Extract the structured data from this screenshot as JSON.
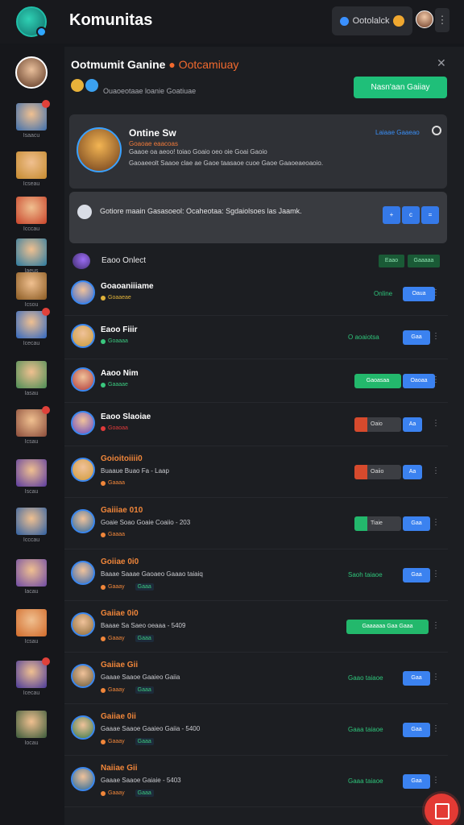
{
  "topbar": {
    "title": "Komunitas",
    "pill_label": "Ootolalck",
    "more_icon": "more-vertical-icon"
  },
  "sidebar": {
    "items": [
      {
        "label": "Isaacu",
        "color": "#3d6fae",
        "badge": true
      },
      {
        "label": "Icseau",
        "color": "#c58a2e",
        "badge": false
      },
      {
        "label": "Icccau",
        "color": "#c8432a",
        "badge": false
      },
      {
        "label": "Iaeus",
        "color": "#2a7aa0",
        "badge": false
      },
      {
        "label": "Icsou",
        "color": "#8a5a22",
        "badge": false
      },
      {
        "label": "Icecau",
        "color": "#2f67c2",
        "badge": true
      },
      {
        "label": "Iasau",
        "color": "#4b8d55",
        "badge": false
      },
      {
        "label": "Icsau",
        "color": "#8a4b3a",
        "badge": true
      },
      {
        "label": "Iscau",
        "color": "#5a3aa0",
        "badge": false
      },
      {
        "label": "Icccau",
        "color": "#2d5fa2",
        "badge": false
      },
      {
        "label": "Iacau",
        "color": "#6e4aa5",
        "badge": false
      },
      {
        "label": "Icsau",
        "color": "#d16a2a",
        "badge": false
      },
      {
        "label": "Icecau",
        "color": "#4a3a9a",
        "badge": true
      },
      {
        "label": "Iocau",
        "color": "#3a5a3a",
        "badge": false
      }
    ]
  },
  "panel": {
    "title": "Ootmumit Ganine",
    "title_accent": "Ootcamiuay",
    "subtitle": "Ouaoeotaae loanie Goatiuae",
    "join_button": "Nasn'aan Gaiiay"
  },
  "featured": {
    "name": "Ontine Sw",
    "tag": "Goaoae eaacoas",
    "line1": "Gaaoe oa aeoo! toiao Goaio oeo oie Goai Gaoio",
    "line2": "Gaoaeeolt Saaoe clae ae Gaoe taasaoe cuoe Gaoe Gaaoeaeoaoio.",
    "link": "Laiaae Gaaeao"
  },
  "notice": {
    "text": "Gotiore maain Gasasoeol: Ocaheotaa: Sgdaiolsoes las Jaamk.",
    "buttons": [
      "+",
      "c",
      "="
    ]
  },
  "members_header": {
    "label": "Eaoo Onlect",
    "btn1": "Eaao",
    "btn2": "Gaaaaa"
  },
  "members": [
    {
      "name": "Goaoaniiiame",
      "name_color": "white",
      "line": "",
      "status": "Goaaeae",
      "status_color": "#e0b23a",
      "tag": "",
      "right_label": "Online",
      "right_type": "online",
      "btn": "Oaua",
      "avatar": "#3a6ad0"
    },
    {
      "name": "Eaoo Fiiir",
      "name_color": "white",
      "line": "",
      "status": "Goaaaa",
      "status_color": "#3ac77e",
      "tag": "",
      "right_label": "O aoaiotsa",
      "right_type": "online",
      "btn": "Gaa",
      "avatar": "#c89a3a"
    },
    {
      "name": "Aaoo Nim",
      "name_color": "white",
      "line": "",
      "status": "Gaaaae",
      "status_color": "#3ac77e",
      "tag": "",
      "right_label": "Gaoasaa",
      "right_type": "green",
      "btn": "Oaoaa",
      "avatar": "#b03a3a"
    },
    {
      "name": "Eaoo Slaoiae",
      "name_color": "white",
      "line": "",
      "status": "Goaoaa",
      "status_color": "#e03a3a",
      "tag": "",
      "right_label": "Oaio",
      "right_type": "red",
      "btn": "Aa",
      "avatar": "#6a4ac0"
    },
    {
      "name": "Goioitoiiii0",
      "name_color": "orange",
      "line": "Buaaue Buao Fa - Laap",
      "status": "Gaaaa",
      "status_color": "#f0863a",
      "tag": "",
      "right_label": "Oaiio",
      "right_type": "red",
      "btn": "Aa",
      "avatar": "#d09a3a"
    },
    {
      "name": "Gaiiiae 010",
      "name_color": "orange",
      "line": "Goaie Soao Goaie Coaiio - 203",
      "status": "Gaaaa",
      "status_color": "#f0863a",
      "tag": "",
      "right_label": "Tiaie",
      "right_type": "greenbox",
      "btn": "Gaa",
      "avatar": "#2f6aa0"
    },
    {
      "name": "Goiiae 0i0",
      "name_color": "orange",
      "line": "Baaae Saaae Gaoaeo Gaaao taiaiq",
      "status": "Gaaay",
      "status_color": "#f0863a",
      "tag": "Gaaa",
      "right_label": "Saoh taiaoe",
      "right_type": "online",
      "btn": "Gaa",
      "avatar": "#3a6ab0"
    },
    {
      "name": "Gaiiae 0i0",
      "name_color": "orange",
      "line": "Baaae Sa Saeo oeaaa - 5409",
      "status": "Gaaay",
      "status_color": "#f0863a",
      "tag": "Gaaa",
      "right_label": "Gaaaaaa Gaa Gaaa",
      "right_type": "greenwide",
      "btn": "",
      "avatar": "#8a6a3a"
    },
    {
      "name": "Gaiiae Gii",
      "name_color": "orange",
      "line": "Gaaae Saaoe Gaaieo Gaiia",
      "status": "Gaaay",
      "status_color": "#f0863a",
      "tag": "Gaaa",
      "right_label": "Gaao taiaoe",
      "right_type": "online",
      "btn": "Gaa",
      "avatar": "#6a5a3a"
    },
    {
      "name": "Gaiiae 0ii",
      "name_color": "orange",
      "line": "Gaaae Saaoe Gaaieo Gaiia - 5400",
      "status": "Gaaay",
      "status_color": "#f0863a",
      "tag": "Gaaa",
      "right_label": "Gaaa taiaoe",
      "right_type": "online",
      "btn": "Gaa",
      "avatar": "#3a7a4a"
    },
    {
      "name": "Naiiae Gii",
      "name_color": "orange",
      "line": "Gaaae Saaoe Gaiaie - 5403",
      "status": "Gaaay",
      "status_color": "#f0863a",
      "tag": "Gaaa",
      "right_label": "Gaaa taiaoe",
      "right_type": "online",
      "btn": "Gaa",
      "avatar": "#2a6a9a"
    }
  ]
}
